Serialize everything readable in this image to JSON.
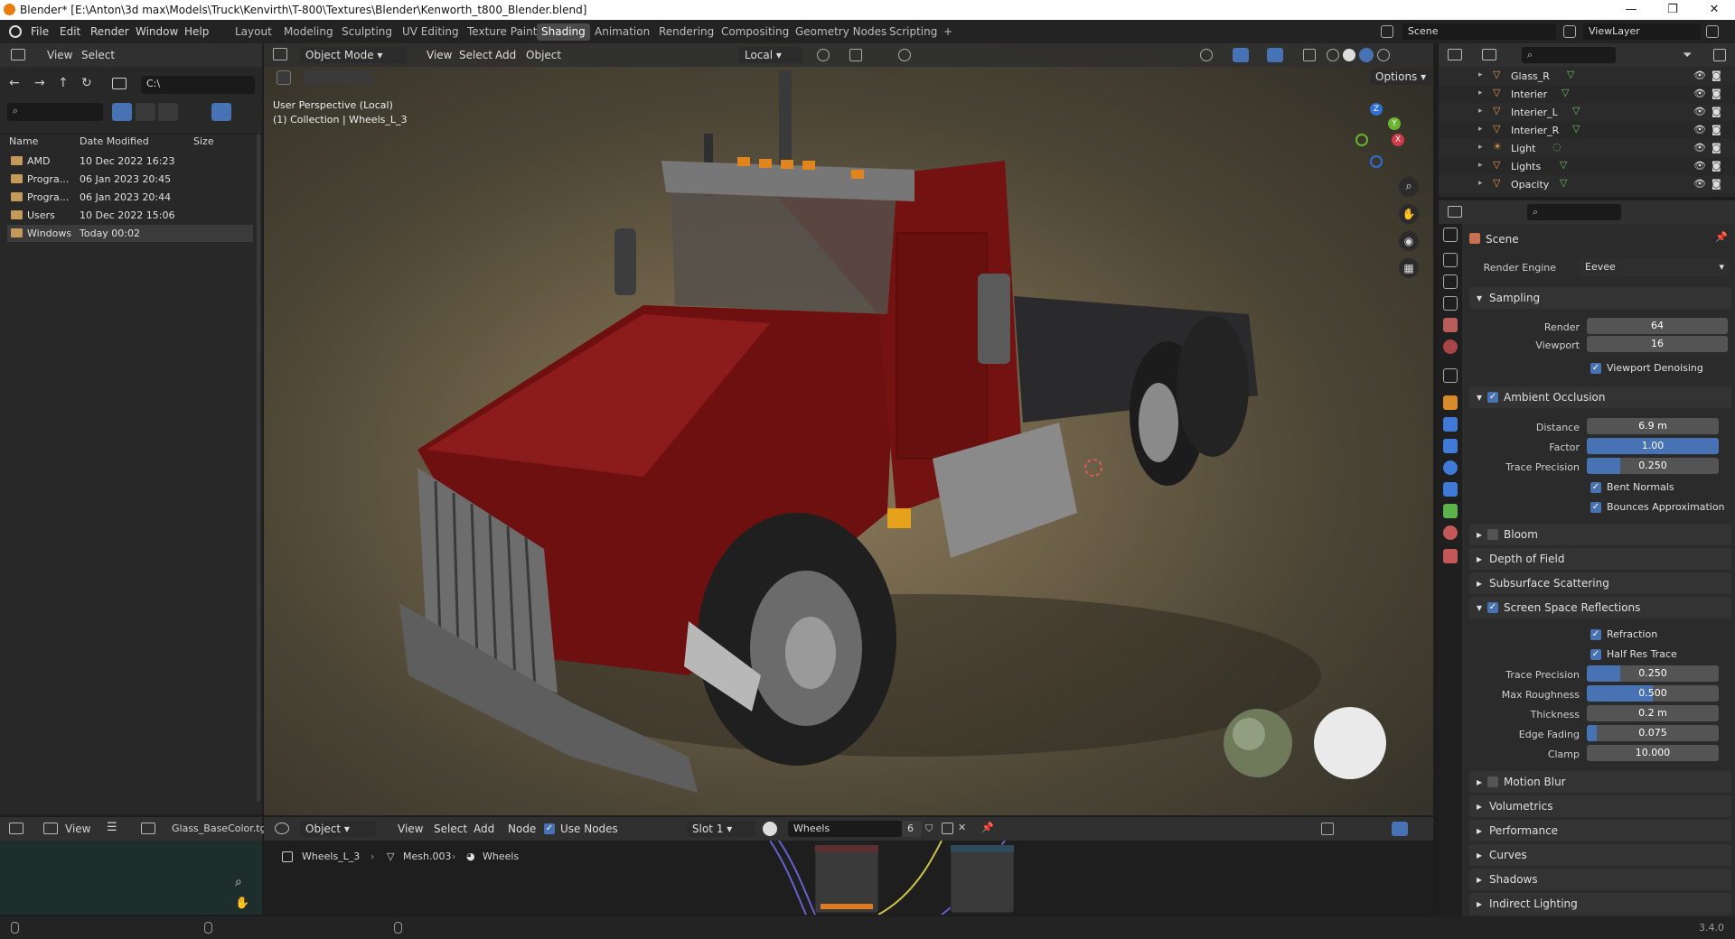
{
  "window": {
    "title": "Blender* [E:\\Anton\\3d max\\Models\\Truck\\Kenvirth\\T-800\\Textures\\Blender\\Kenworth_t800_Blender.blend]",
    "controls": {
      "minimize": "—",
      "maximize": "❐",
      "close": "✕"
    }
  },
  "menu": [
    "File",
    "Edit",
    "Render",
    "Window",
    "Help"
  ],
  "workspaces": [
    "Layout",
    "Modeling",
    "Sculpting",
    "UV Editing",
    "Texture Paint",
    "Shading",
    "Animation",
    "Rendering",
    "Compositing",
    "Geometry Nodes",
    "Scripting",
    "+"
  ],
  "active_workspace": "Shading",
  "scene": {
    "name": "Scene",
    "view_layer": "ViewLayer"
  },
  "file_browser": {
    "menus": [
      "View",
      "Select"
    ],
    "path": "C:\\",
    "columns": [
      "Name",
      "Date Modified",
      "Size"
    ],
    "rows": [
      {
        "name": "AMD",
        "date": "10 Dec 2022 16:23"
      },
      {
        "name": "Progra...",
        "date": "06 Jan 2023 20:45"
      },
      {
        "name": "Progra...",
        "date": "06 Jan 2023 20:44"
      },
      {
        "name": "Users",
        "date": "10 Dec 2022 15:06"
      },
      {
        "name": "Windows",
        "date": "Today 00:02"
      }
    ]
  },
  "viewport": {
    "mode": "Object Mode",
    "menus": [
      "View",
      "Select",
      "Add",
      "Object"
    ],
    "transform_orientation": "Local",
    "options_label": "Options",
    "overlay_line1": "User Perspective (Local)",
    "overlay_line2": "(1) Collection | Wheels_L_3",
    "gizmo": {
      "z": "Z",
      "y": "Y",
      "x": "X"
    }
  },
  "outliner": {
    "items": [
      {
        "name": "Glass_R",
        "icon": "mesh"
      },
      {
        "name": "Interier",
        "icon": "mesh"
      },
      {
        "name": "Interier_L",
        "icon": "mesh"
      },
      {
        "name": "Interier_R",
        "icon": "mesh"
      },
      {
        "name": "Light",
        "icon": "light"
      },
      {
        "name": "Lights",
        "icon": "mesh"
      },
      {
        "name": "Opacity",
        "icon": "mesh"
      }
    ]
  },
  "properties": {
    "context": "Scene",
    "render_engine_label": "Render Engine",
    "render_engine": "Eevee",
    "sampling": {
      "title": "Sampling",
      "render_label": "Render",
      "render": "64",
      "viewport_label": "Viewport",
      "viewport": "16",
      "denoise_label": "Viewport Denoising"
    },
    "ao": {
      "title": "Ambient Occlusion",
      "distance_label": "Distance",
      "distance": "6.9 m",
      "factor_label": "Factor",
      "factor": "1.00",
      "factor_fill": 1.0,
      "trace_label": "Trace Precision",
      "trace": "0.250",
      "trace_fill": 0.25,
      "bent_label": "Bent Normals",
      "bounces_label": "Bounces Approximation"
    },
    "bloom": "Bloom",
    "dof": "Depth of Field",
    "sss": "Subsurface Scattering",
    "ssr": {
      "title": "Screen Space Reflections",
      "refraction_label": "Refraction",
      "halfres_label": "Half Res Trace",
      "trace_label": "Trace Precision",
      "trace": "0.250",
      "trace_fill": 0.25,
      "rough_label": "Max Roughness",
      "rough": "0.500",
      "rough_fill": 0.5,
      "thick_label": "Thickness",
      "thick": "0.2 m",
      "fade_label": "Edge Fading",
      "fade": "0.075",
      "fade_fill": 0.075,
      "clamp_label": "Clamp",
      "clamp": "10.000"
    },
    "motion_blur": "Motion Blur",
    "volumetrics": "Volumetrics",
    "performance": "Performance",
    "curves": "Curves",
    "shadows": "Shadows",
    "indirect": "Indirect Lighting"
  },
  "image_editor": {
    "view": "View",
    "image": "Glass_BaseColor.tga"
  },
  "node_editor": {
    "type": "Object",
    "menus": [
      "View",
      "Select",
      "Add",
      "Node"
    ],
    "use_nodes_label": "Use Nodes",
    "slot": "Slot 1",
    "material": "Wheels",
    "users": "6",
    "breadcrumb": [
      "Wheels_L_3",
      "Mesh.003",
      "Wheels"
    ]
  },
  "status": {
    "version": "3.4.0"
  },
  "colors": {
    "accent": "#4772b3",
    "truck": "#7a1414",
    "header": "#303030"
  }
}
